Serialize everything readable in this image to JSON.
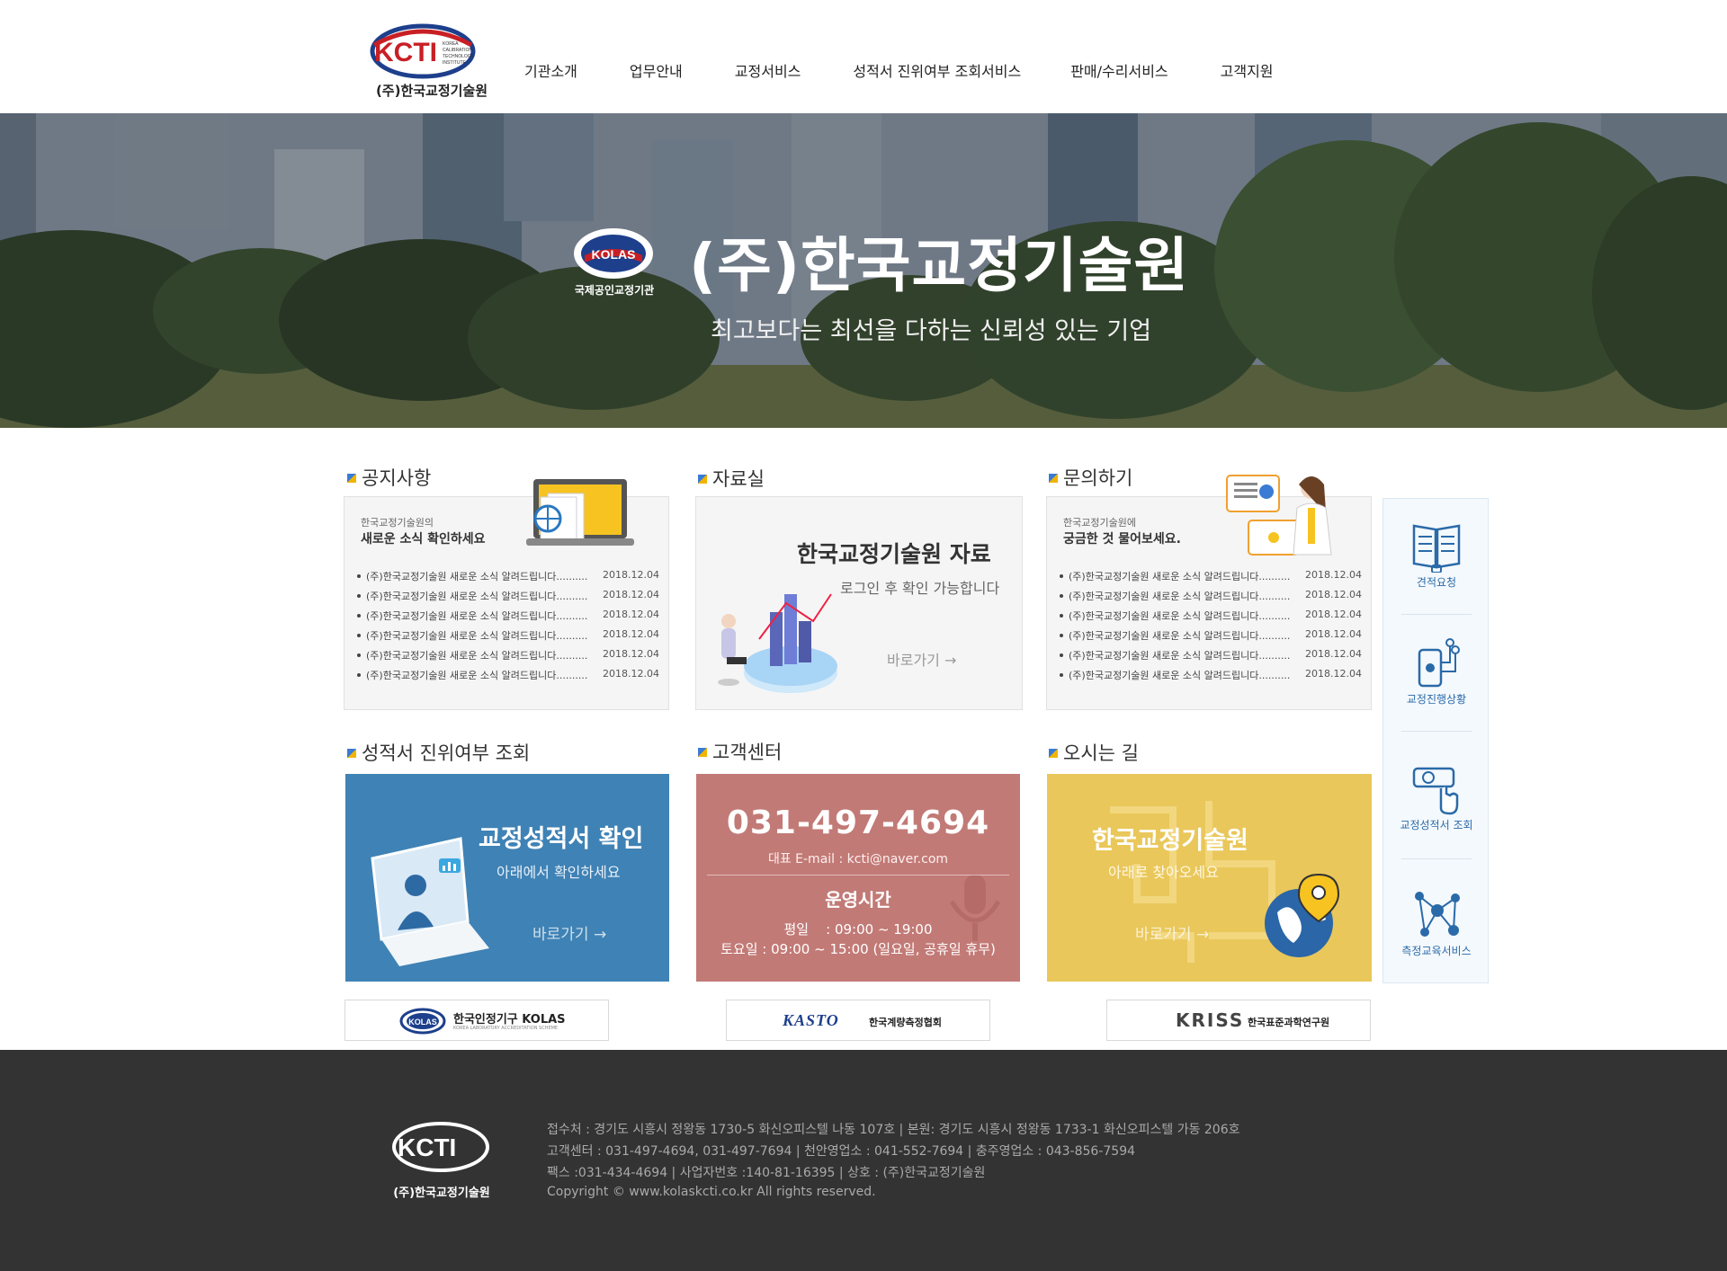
{
  "header": {
    "logo_text": "KCTI",
    "logo_small": "KOREA CALIBRATION TECHNOLOGY INSTITUTE",
    "logo_sub": "(주)한국교정기술원",
    "nav": [
      "기관소개",
      "업무안내",
      "교정서비스",
      "성적서 진위여부 조회서비스",
      "판매/수리서비스",
      "고객지원"
    ]
  },
  "hero": {
    "badge_text": "KOLAS",
    "badge_caption": "국제공인교정기관",
    "title": "(주)한국교정기술원",
    "subtitle": "최고보다는 최선을 다하는 신뢰성 있는 기업"
  },
  "notice": {
    "title": "공지사항",
    "head_small": "한국교정기술원의",
    "head_big": "새로운 소식 확인하세요",
    "items": [
      {
        "title": "(주)한국교정기술원 새로운 소식 알려드립니다..........",
        "date": "2018.12.04"
      },
      {
        "title": "(주)한국교정기술원 새로운 소식 알려드립니다..........",
        "date": "2018.12.04"
      },
      {
        "title": "(주)한국교정기술원 새로운 소식 알려드립니다..........",
        "date": "2018.12.04"
      },
      {
        "title": "(주)한국교정기술원 새로운 소식 알려드립니다..........",
        "date": "2018.12.04"
      },
      {
        "title": "(주)한국교정기술원 새로운 소식 알려드립니다..........",
        "date": "2018.12.04"
      },
      {
        "title": "(주)한국교정기술원 새로운 소식 알려드립니다..........",
        "date": "2018.12.04"
      }
    ]
  },
  "archive": {
    "title": "자료실",
    "head": "한국교정기술원 자료",
    "sub": "로그인 후 확인 가능합니다",
    "go": "바로가기 →"
  },
  "inquiry": {
    "title": "문의하기",
    "head_small": "한국교정기술원에",
    "head_big": "궁금한 것 물어보세요.",
    "items": [
      {
        "title": "(주)한국교정기술원 새로운 소식 알려드립니다..........",
        "date": "2018.12.04"
      },
      {
        "title": "(주)한국교정기술원 새로운 소식 알려드립니다..........",
        "date": "2018.12.04"
      },
      {
        "title": "(주)한국교정기술원 새로운 소식 알려드립니다..........",
        "date": "2018.12.04"
      },
      {
        "title": "(주)한국교정기술원 새로운 소식 알려드립니다..........",
        "date": "2018.12.04"
      },
      {
        "title": "(주)한국교정기술원 새로운 소식 알려드립니다..........",
        "date": "2018.12.04"
      },
      {
        "title": "(주)한국교정기술원 새로운 소식 알려드립니다..........",
        "date": "2018.12.04"
      }
    ]
  },
  "verify": {
    "title": "성적서 진위여부 조회",
    "head": "교정성적서 확인",
    "sub": "아래에서 확인하세요",
    "go": "바로가기 →",
    "color": "#3f82b5"
  },
  "support": {
    "title": "고객센터",
    "phone": "031-497-4694",
    "email": "대표 E-mail : kcti@naver.com",
    "hours_title": "운영시간",
    "weekday": "평일    : 09:00 ~ 19:00",
    "saturday": "토요일 : 09:00 ~ 15:00 (일요일, 공휴일 휴무)",
    "color": "#c27a76"
  },
  "directions": {
    "title": "오시는 길",
    "head": "한국교정기술원",
    "sub": "아래로 찾아오세요",
    "go": "바로가기 →",
    "color": "#e9c75a"
  },
  "quick_menu": [
    {
      "label": "견적요청",
      "icon": "book-icon"
    },
    {
      "label": "교정진행상황",
      "icon": "process-icon"
    },
    {
      "label": "교정성적서 조회",
      "icon": "search-cert-icon"
    },
    {
      "label": "측정교육서비스",
      "icon": "network-icon"
    }
  ],
  "partners": [
    {
      "name": "한국인정기구 KOLAS",
      "sub": "KOREA LABORATORY ACCREDITATION SCHEME",
      "badge": "KOLAS"
    },
    {
      "name": "한국계량측정협회",
      "badge": "KASTO"
    },
    {
      "name": "한국표준과학연구원",
      "badge": "KRISS"
    }
  ],
  "footer": {
    "logo_text": "KCTI",
    "logo_sub": "(주)한국교정기술원",
    "lines": [
      "접수처 : 경기도 시흥시 정왕동 1730-5 화신오피스텔 나동 107호 | 본원: 경기도 시흥시 정왕동 1733-1 화신오피스텔 가동 206호",
      "고객센터 : 031-497-4694, 031-497-7694 | 천안영업소 : 041-552-7694 | 충주영업소 : 043-856-7594",
      "팩스 :031-434-4694 | 사업자번호 :140-81-16395 | 상호 : (주)한국교정기술원",
      "Copyright © www.kolaskcti.co.kr All rights reserved."
    ]
  }
}
